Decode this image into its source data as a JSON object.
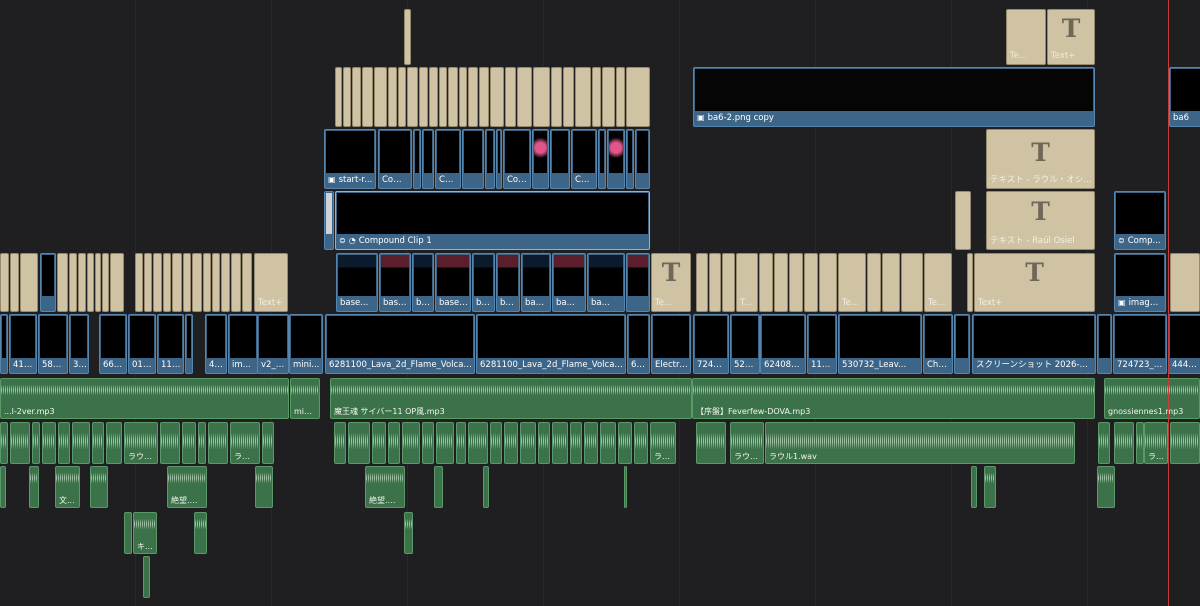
{
  "timeline": {
    "playhead_color": "#c83b3b",
    "text_glyph": "T"
  },
  "v6": {
    "text_clips": [
      "Te...",
      "Text+"
    ]
  },
  "v5": {
    "image_clip": "ba6-2.png copy",
    "image_clip_right": "ba6"
  },
  "v4": {
    "clips": [
      "start-r...",
      "Com...",
      "Co...",
      "Com...",
      "Co..."
    ],
    "text_clip": "テキスト - ラウル・オシエル・マロ..."
  },
  "v3": {
    "compound_clip": "Compound Clip 1",
    "text_clip": "テキスト - Raúl Osiel",
    "compound_right": "Comp..."
  },
  "v2": {
    "clips": [
      "base...",
      "base...",
      "ba...",
      "base2...",
      "ba...",
      "base...",
      "base2...",
      "ba...",
      "ba..."
    ],
    "text_labels": [
      "Text+",
      "Te...",
      "Te...",
      "Text...",
      "Text+",
      "Text+"
    ],
    "image_right": "image..."
  },
  "v1": {
    "clips": [
      "...",
      "412...",
      "581...",
      "3...",
      "66...",
      "01w...",
      "114...",
      "46...",
      "im...",
      "v2_df...",
      "mini...",
      "6281100_Lava_2d_Flame_Volcano_By...",
      "6281100_Lava_2d_Flame_Volcano_By...",
      "62...",
      "Electro...",
      "72472...",
      "525...",
      "6240884...",
      "1154...",
      "530732_Leav...",
      "Chat...",
      "スクリーンショット 2026-04-1...",
      "724723_Dr...",
      "444124_..."
    ]
  },
  "a1": {
    "clips": [
      "...l-2ver.mp3",
      "mini...",
      "魔王魂 サイバー11 OP風.mp3",
      "【序盤】Feverfew-DOVA.mp3",
      "gnossiennes1.mp3"
    ]
  },
  "a2": {
    "labels": [
      "ラウル...",
      "ラウ...",
      "ラウ...",
      "ラウル...",
      "ラウル1.wav",
      "ラウル...",
      "ラウル1.w..."
    ]
  },
  "a3": {
    "labels": [
      "文...",
      "絶望.m...",
      "絶望.m..."
    ]
  },
  "a4": {
    "labels": [
      "キ..."
    ]
  }
}
